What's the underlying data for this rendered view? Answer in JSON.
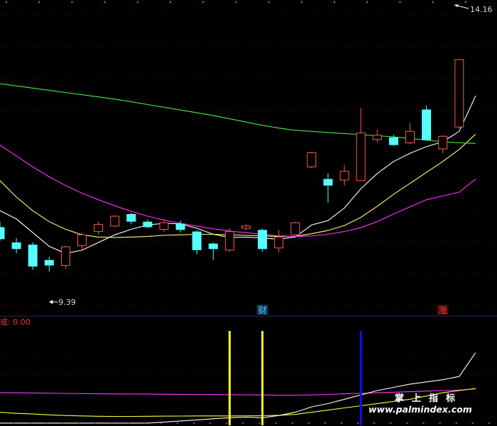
{
  "chart_data": {
    "type": "candlestick",
    "price_panel": {
      "high_label": "14.16",
      "low_label": "9.39",
      "ylim": [
        8.6,
        14.35
      ],
      "grid": "horizontal dotted",
      "badges": [
        {
          "text": "财",
          "index": 16,
          "color": "#5ec8f0",
          "bg": "#103a58"
        },
        {
          "text": "涨",
          "index": 27,
          "color": "#ff4040",
          "bg": "#4a0a0a"
        }
      ],
      "candles": [
        {
          "o": 10.2,
          "h": 10.3,
          "l": 9.95,
          "c": 9.98,
          "up": false
        },
        {
          "o": 9.92,
          "h": 10.0,
          "l": 9.72,
          "c": 9.8,
          "up": false
        },
        {
          "o": 9.88,
          "h": 9.92,
          "l": 9.42,
          "c": 9.48,
          "up": false
        },
        {
          "o": 9.6,
          "h": 9.66,
          "l": 9.39,
          "c": 9.5,
          "up": false
        },
        {
          "o": 9.5,
          "h": 9.86,
          "l": 9.44,
          "c": 9.84,
          "up": true
        },
        {
          "o": 9.86,
          "h": 10.1,
          "l": 9.8,
          "c": 10.06,
          "up": true
        },
        {
          "o": 10.12,
          "h": 10.3,
          "l": 10.06,
          "c": 10.25,
          "up": true
        },
        {
          "o": 10.22,
          "h": 10.42,
          "l": 10.2,
          "c": 10.4,
          "up": true
        },
        {
          "o": 10.44,
          "h": 10.46,
          "l": 10.25,
          "c": 10.3,
          "up": false
        },
        {
          "o": 10.3,
          "h": 10.34,
          "l": 10.18,
          "c": 10.2,
          "up": false
        },
        {
          "o": 10.16,
          "h": 10.33,
          "l": 10.12,
          "c": 10.28,
          "up": true
        },
        {
          "o": 10.26,
          "h": 10.32,
          "l": 10.1,
          "c": 10.15,
          "up": false
        },
        {
          "o": 10.12,
          "h": 10.14,
          "l": 9.7,
          "c": 9.78,
          "up": false
        },
        {
          "o": 9.9,
          "h": 9.92,
          "l": 9.6,
          "c": 9.8,
          "up": false
        },
        {
          "o": 9.78,
          "h": 10.18,
          "l": 9.75,
          "c": 10.12,
          "up": true
        },
        {
          "o": 10.18,
          "h": 10.25,
          "l": 10.14,
          "c": 10.22,
          "up": true
        },
        {
          "o": 10.15,
          "h": 10.17,
          "l": 9.75,
          "c": 9.8,
          "up": false
        },
        {
          "o": 9.82,
          "h": 10.15,
          "l": 9.74,
          "c": 10.02,
          "up": true
        },
        {
          "o": 10.06,
          "h": 10.3,
          "l": 10.04,
          "c": 10.28,
          "up": true
        },
        {
          "o": 11.3,
          "h": 11.58,
          "l": 11.28,
          "c": 11.56,
          "up": true
        },
        {
          "o": 11.08,
          "h": 11.18,
          "l": 10.65,
          "c": 10.96,
          "up": false
        },
        {
          "o": 11.06,
          "h": 11.34,
          "l": 10.96,
          "c": 11.22,
          "up": true
        },
        {
          "o": 11.05,
          "h": 12.38,
          "l": 11.04,
          "c": 11.92,
          "up": true
        },
        {
          "o": 11.8,
          "h": 11.98,
          "l": 11.75,
          "c": 11.88,
          "up": true
        },
        {
          "o": 11.84,
          "h": 11.89,
          "l": 11.68,
          "c": 11.7,
          "up": false
        },
        {
          "o": 11.74,
          "h": 12.1,
          "l": 11.72,
          "c": 11.95,
          "up": true
        },
        {
          "o": 12.35,
          "h": 12.42,
          "l": 11.78,
          "c": 11.79,
          "up": false
        },
        {
          "o": 11.63,
          "h": 11.88,
          "l": 11.55,
          "c": 11.86,
          "up": true
        },
        {
          "o": 12.03,
          "h": 13.27,
          "l": 12.0,
          "c": 13.26,
          "up": true
        }
      ],
      "ma_lines": [
        {
          "color": "#ffffff",
          "values": [
            10.5,
            10.35,
            10.1,
            9.85,
            9.72,
            9.78,
            9.92,
            10.06,
            10.16,
            10.24,
            10.27,
            10.26,
            10.18,
            10.07,
            10.01,
            10.02,
            10.0,
            9.98,
            10.02,
            10.24,
            10.32,
            10.55,
            10.9,
            11.18,
            11.4,
            11.55,
            11.67,
            11.76,
            11.95,
            12.6
          ]
        },
        {
          "color": "#ffff66",
          "values": [
            11.05,
            10.75,
            10.5,
            10.3,
            10.16,
            10.06,
            10.02,
            10.01,
            10.02,
            10.03,
            10.05,
            10.06,
            10.07,
            10.07,
            10.06,
            10.05,
            10.04,
            10.03,
            10.03,
            10.08,
            10.14,
            10.23,
            10.38,
            10.58,
            10.8,
            11.0,
            11.2,
            11.4,
            11.62,
            11.9
          ]
        },
        {
          "color": "#ff33ff",
          "values": [
            11.7,
            11.5,
            11.3,
            11.12,
            10.96,
            10.82,
            10.7,
            10.59,
            10.49,
            10.4,
            10.33,
            10.27,
            10.22,
            10.17,
            10.13,
            10.1,
            10.07,
            10.04,
            10.03,
            10.04,
            10.07,
            10.12,
            10.19,
            10.3,
            10.44,
            10.57,
            10.7,
            10.77,
            10.84,
            11.08
          ]
        },
        {
          "color": "#44ee44",
          "values": [
            12.82,
            12.78,
            12.74,
            12.7,
            12.66,
            12.62,
            12.58,
            12.54,
            12.49,
            12.44,
            12.39,
            12.34,
            12.29,
            12.24,
            12.18,
            12.12,
            12.06,
            12.01,
            11.97,
            11.95,
            11.93,
            11.91,
            11.89,
            11.87,
            11.85,
            11.82,
            11.79,
            11.76,
            11.74,
            11.73
          ]
        }
      ]
    },
    "indicator_panel": {
      "label": "或: 0.00",
      "ylim": [
        0,
        100
      ],
      "signals": [
        {
          "index": 14,
          "color": "#ffff22"
        },
        {
          "index": 16,
          "color": "#ffff22"
        },
        {
          "index": 22,
          "color": "#1010ee"
        }
      ],
      "lines": [
        {
          "color": "#ff33ff",
          "values": [
            30,
            30,
            29.8,
            29.6,
            29.4,
            29.2,
            29,
            28.9,
            28.8,
            28.7,
            28.6,
            28.5,
            28.4,
            28.3,
            28.2,
            28.1,
            28,
            27.8,
            27.8,
            28,
            28.4,
            29,
            29.5,
            30,
            30.5,
            31,
            31.6,
            32,
            32.5,
            33.5
          ]
        },
        {
          "color": "#ffff33",
          "values": [
            12,
            11,
            10.4,
            9.6,
            9,
            8.6,
            8.3,
            8.2,
            8.2,
            8.3,
            8.4,
            8.5,
            8.6,
            8.6,
            8.6,
            8.7,
            8.8,
            9.2,
            10,
            12,
            14,
            16,
            18,
            20,
            22,
            24,
            27,
            30,
            32,
            34
          ]
        },
        {
          "color": "#ffffff",
          "values": [
            2,
            2,
            2,
            2,
            2,
            2,
            2,
            2,
            2,
            2,
            3,
            4,
            5,
            6,
            7,
            7.5,
            7,
            9,
            12,
            17,
            20,
            24,
            28,
            32,
            35,
            38,
            40,
            42,
            45,
            67
          ]
        }
      ]
    }
  },
  "watermark": {
    "cn_chars": [
      "掌",
      "上",
      "指",
      "标"
    ],
    "url": "www.palmindex.com"
  }
}
